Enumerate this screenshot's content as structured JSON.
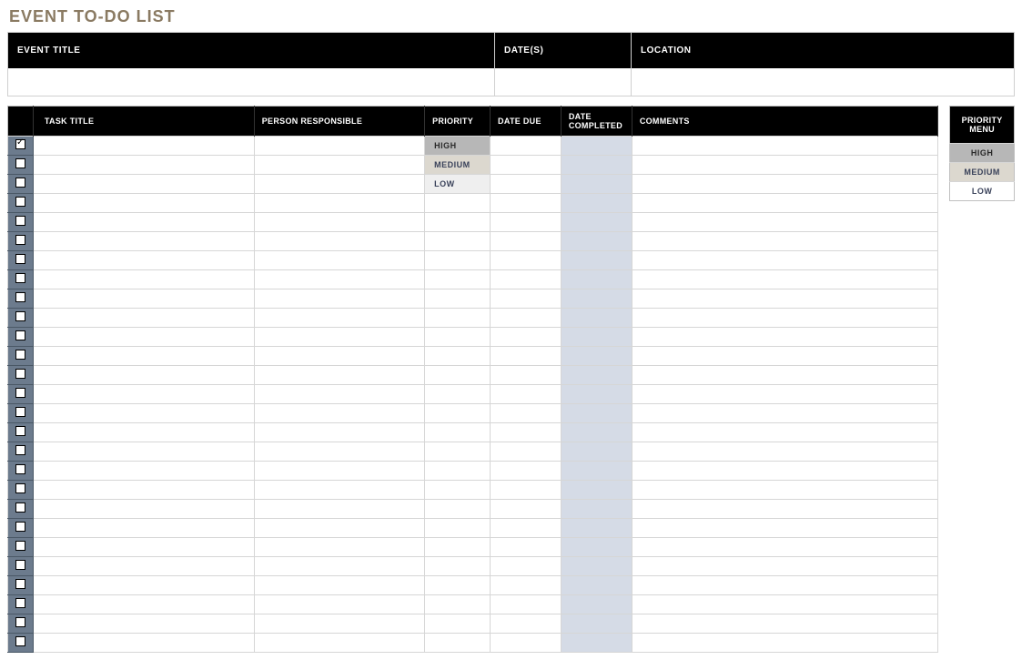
{
  "title": "EVENT TO-DO LIST",
  "eventHeader": {
    "eventTitle_label": "EVENT TITLE",
    "dates_label": "DATE(S)",
    "location_label": "LOCATION",
    "eventTitle_value": "",
    "dates_value": "",
    "location_value": ""
  },
  "columns": {
    "check": "",
    "taskTitle": "TASK TITLE",
    "person": "PERSON RESPONSIBLE",
    "priority": "PRIORITY",
    "dateDue": "DATE DUE",
    "dateCompleted": "DATE COMPLETED",
    "comments": "COMMENTS"
  },
  "priorityMenu": {
    "header": "PRIORITY MENU",
    "high": "HIGH",
    "medium": "MEDIUM",
    "low": "LOW"
  },
  "rows": [
    {
      "checked": true,
      "taskTitle": "",
      "person": "",
      "priority": "HIGH",
      "priorityClass": "prio-high",
      "dateDue": "",
      "dateCompleted": "",
      "comments": ""
    },
    {
      "checked": false,
      "taskTitle": "",
      "person": "",
      "priority": "MEDIUM",
      "priorityClass": "prio-med",
      "dateDue": "",
      "dateCompleted": "",
      "comments": ""
    },
    {
      "checked": false,
      "taskTitle": "",
      "person": "",
      "priority": "LOW",
      "priorityClass": "prio-low",
      "dateDue": "",
      "dateCompleted": "",
      "comments": ""
    },
    {
      "checked": false,
      "taskTitle": "",
      "person": "",
      "priority": "",
      "priorityClass": "",
      "dateDue": "",
      "dateCompleted": "",
      "comments": ""
    },
    {
      "checked": false,
      "taskTitle": "",
      "person": "",
      "priority": "",
      "priorityClass": "",
      "dateDue": "",
      "dateCompleted": "",
      "comments": ""
    },
    {
      "checked": false,
      "taskTitle": "",
      "person": "",
      "priority": "",
      "priorityClass": "",
      "dateDue": "",
      "dateCompleted": "",
      "comments": ""
    },
    {
      "checked": false,
      "taskTitle": "",
      "person": "",
      "priority": "",
      "priorityClass": "",
      "dateDue": "",
      "dateCompleted": "",
      "comments": ""
    },
    {
      "checked": false,
      "taskTitle": "",
      "person": "",
      "priority": "",
      "priorityClass": "",
      "dateDue": "",
      "dateCompleted": "",
      "comments": ""
    },
    {
      "checked": false,
      "taskTitle": "",
      "person": "",
      "priority": "",
      "priorityClass": "",
      "dateDue": "",
      "dateCompleted": "",
      "comments": ""
    },
    {
      "checked": false,
      "taskTitle": "",
      "person": "",
      "priority": "",
      "priorityClass": "",
      "dateDue": "",
      "dateCompleted": "",
      "comments": ""
    },
    {
      "checked": false,
      "taskTitle": "",
      "person": "",
      "priority": "",
      "priorityClass": "",
      "dateDue": "",
      "dateCompleted": "",
      "comments": ""
    },
    {
      "checked": false,
      "taskTitle": "",
      "person": "",
      "priority": "",
      "priorityClass": "",
      "dateDue": "",
      "dateCompleted": "",
      "comments": ""
    },
    {
      "checked": false,
      "taskTitle": "",
      "person": "",
      "priority": "",
      "priorityClass": "",
      "dateDue": "",
      "dateCompleted": "",
      "comments": ""
    },
    {
      "checked": false,
      "taskTitle": "",
      "person": "",
      "priority": "",
      "priorityClass": "",
      "dateDue": "",
      "dateCompleted": "",
      "comments": ""
    },
    {
      "checked": false,
      "taskTitle": "",
      "person": "",
      "priority": "",
      "priorityClass": "",
      "dateDue": "",
      "dateCompleted": "",
      "comments": ""
    },
    {
      "checked": false,
      "taskTitle": "",
      "person": "",
      "priority": "",
      "priorityClass": "",
      "dateDue": "",
      "dateCompleted": "",
      "comments": ""
    },
    {
      "checked": false,
      "taskTitle": "",
      "person": "",
      "priority": "",
      "priorityClass": "",
      "dateDue": "",
      "dateCompleted": "",
      "comments": ""
    },
    {
      "checked": false,
      "taskTitle": "",
      "person": "",
      "priority": "",
      "priorityClass": "",
      "dateDue": "",
      "dateCompleted": "",
      "comments": ""
    },
    {
      "checked": false,
      "taskTitle": "",
      "person": "",
      "priority": "",
      "priorityClass": "",
      "dateDue": "",
      "dateCompleted": "",
      "comments": ""
    },
    {
      "checked": false,
      "taskTitle": "",
      "person": "",
      "priority": "",
      "priorityClass": "",
      "dateDue": "",
      "dateCompleted": "",
      "comments": ""
    },
    {
      "checked": false,
      "taskTitle": "",
      "person": "",
      "priority": "",
      "priorityClass": "",
      "dateDue": "",
      "dateCompleted": "",
      "comments": ""
    },
    {
      "checked": false,
      "taskTitle": "",
      "person": "",
      "priority": "",
      "priorityClass": "",
      "dateDue": "",
      "dateCompleted": "",
      "comments": ""
    },
    {
      "checked": false,
      "taskTitle": "",
      "person": "",
      "priority": "",
      "priorityClass": "",
      "dateDue": "",
      "dateCompleted": "",
      "comments": ""
    },
    {
      "checked": false,
      "taskTitle": "",
      "person": "",
      "priority": "",
      "priorityClass": "",
      "dateDue": "",
      "dateCompleted": "",
      "comments": ""
    },
    {
      "checked": false,
      "taskTitle": "",
      "person": "",
      "priority": "",
      "priorityClass": "",
      "dateDue": "",
      "dateCompleted": "",
      "comments": ""
    },
    {
      "checked": false,
      "taskTitle": "",
      "person": "",
      "priority": "",
      "priorityClass": "",
      "dateDue": "",
      "dateCompleted": "",
      "comments": ""
    },
    {
      "checked": false,
      "taskTitle": "",
      "person": "",
      "priority": "",
      "priorityClass": "",
      "dateDue": "",
      "dateCompleted": "",
      "comments": ""
    }
  ]
}
